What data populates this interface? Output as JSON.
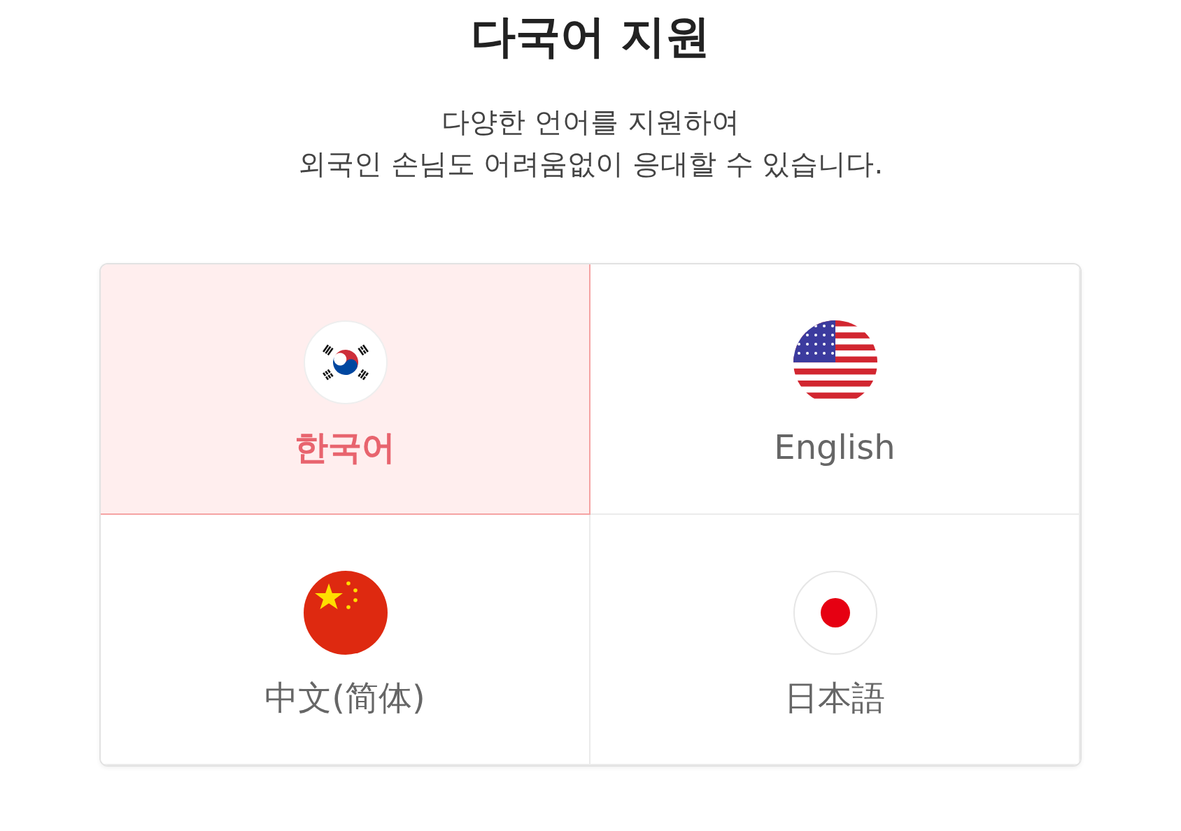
{
  "title": "다국어 지원",
  "subtitle_lines": [
    "다양한 언어를 지원하여",
    "외국인 손님도 어려움없이 응대할 수 있습니다."
  ],
  "languages": [
    {
      "label": "한국어",
      "selected": true,
      "kind": "korea"
    },
    {
      "label": "English",
      "selected": false,
      "kind": "usa"
    },
    {
      "label": "中文(简体)",
      "selected": false,
      "kind": "china"
    },
    {
      "label": "日本語",
      "selected": false,
      "kind": "japan"
    }
  ]
}
